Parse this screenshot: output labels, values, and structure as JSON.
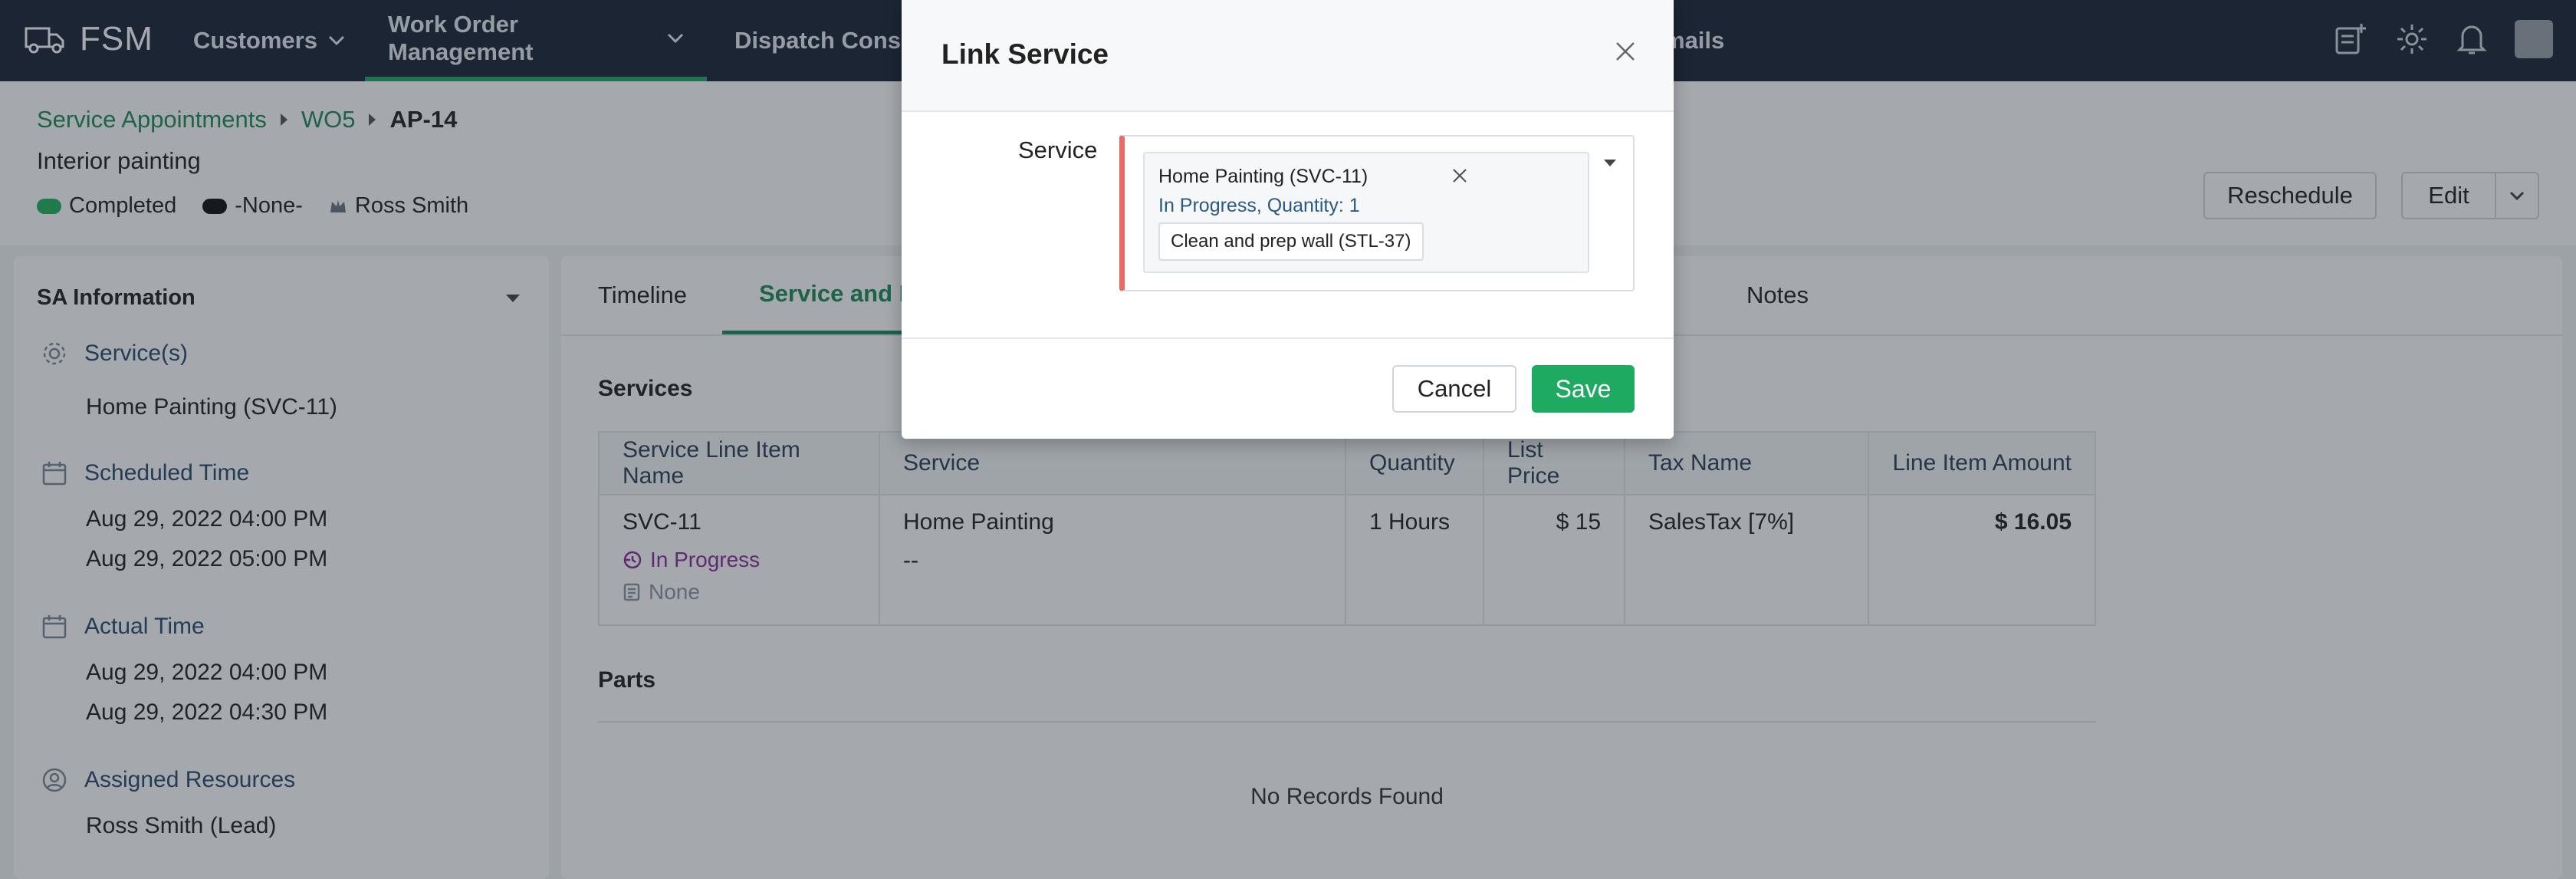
{
  "app": {
    "logo_text": "FSM"
  },
  "nav": {
    "items": [
      {
        "label": "Customers"
      },
      {
        "label": "Work Order Management"
      },
      {
        "label": "Dispatch Console"
      },
      {
        "label": "mails"
      }
    ]
  },
  "breadcrumb": {
    "items": [
      "Service Appointments",
      "WO5"
    ],
    "current": "AP-14"
  },
  "record": {
    "subtitle": "Interior painting",
    "status": "Completed",
    "status_color": "#22b35e",
    "priority": "-None-",
    "owner": "Ross Smith"
  },
  "header_actions": {
    "reschedule": "Reschedule",
    "edit": "Edit"
  },
  "sa_info": {
    "title": "SA Information",
    "services_label": "Service(s)",
    "services_value": "Home Painting (SVC-11)",
    "scheduled_label": "Scheduled Time",
    "scheduled_start": "Aug 29, 2022 04:00 PM",
    "scheduled_end": "Aug 29, 2022 05:00 PM",
    "actual_label": "Actual Time",
    "actual_start": "Aug 29, 2022 04:00 PM",
    "actual_end": "Aug 29, 2022 04:30 PM",
    "resources_label": "Assigned Resources",
    "resources_value": "Ross Smith (Lead)"
  },
  "tabs": [
    {
      "label": "Timeline"
    },
    {
      "label": "Service and Parts"
    },
    {
      "label": "Notes"
    }
  ],
  "services": {
    "title": "Services",
    "columns": [
      "Service Line Item Name",
      "Service",
      "Quantity",
      "List Price",
      "Tax Name",
      "Line Item Amount"
    ],
    "row": {
      "line_item": "SVC-11",
      "status": "In Progress",
      "sub_status": "None",
      "service": "Home Painting",
      "service_sub": "--",
      "quantity": "1 Hours",
      "list_price": "$ 15",
      "tax_name": "SalesTax [7%]",
      "amount": "$ 16.05"
    }
  },
  "parts": {
    "title": "Parts",
    "empty": "No Records Found"
  },
  "modal": {
    "title": "Link Service",
    "field_label": "Service",
    "selected_title": "Home Painting  (SVC-11)",
    "selected_sub": "In Progress,  Quantity: 1",
    "selected_tag": "Clean and prep wall  (STL-37)",
    "cancel": "Cancel",
    "save": "Save"
  }
}
